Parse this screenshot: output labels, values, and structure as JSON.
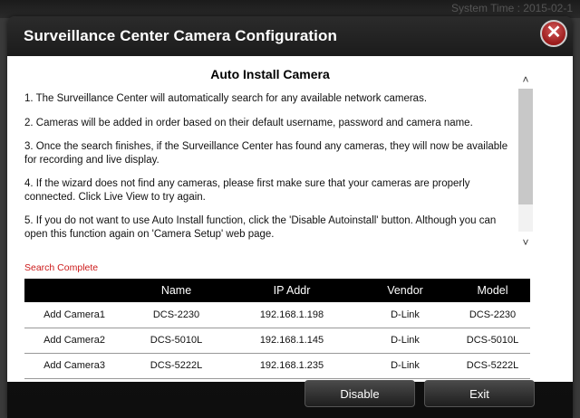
{
  "background": {
    "system_time_text": "System Time : 2015-02-1"
  },
  "dialog": {
    "title": "Surveillance Center Camera Configuration",
    "close_symbol": "✕",
    "heading": "Auto Install Camera",
    "paragraphs": [
      "1. The Surveillance Center will automatically search for any available network cameras.",
      "2. Cameras will be added in order based on their default username, password and camera name.",
      "3. Once the search finishes, if the Surveillance Center has found any cameras, they will now be available for recording and live display.",
      "4. If the wizard does not find any cameras, please first make sure that your cameras are properly connected. Click Live View to try again.",
      "5. If you do not want to use Auto Install function, click the 'Disable Autoinstall' button. Although you can open this function again on 'Camera Setup' web page."
    ],
    "status": "Search Complete",
    "status_color": "#cc1a1a",
    "table": {
      "headers": [
        "",
        "Name",
        "IP Addr",
        "Vendor",
        "Model"
      ],
      "rows": [
        [
          "Add Camera1",
          "DCS-2230",
          "192.168.1.198",
          "D-Link",
          "DCS-2230"
        ],
        [
          "Add Camera2",
          "DCS-5010L",
          "192.168.1.145",
          "D-Link",
          "DCS-5010L"
        ],
        [
          "Add Camera3",
          "DCS-5222L",
          "192.168.1.235",
          "D-Link",
          "DCS-5222L"
        ]
      ]
    },
    "buttons": {
      "disable": "Disable",
      "exit": "Exit"
    },
    "scroll_up_icon": "˄",
    "scroll_down_icon": "˅"
  }
}
